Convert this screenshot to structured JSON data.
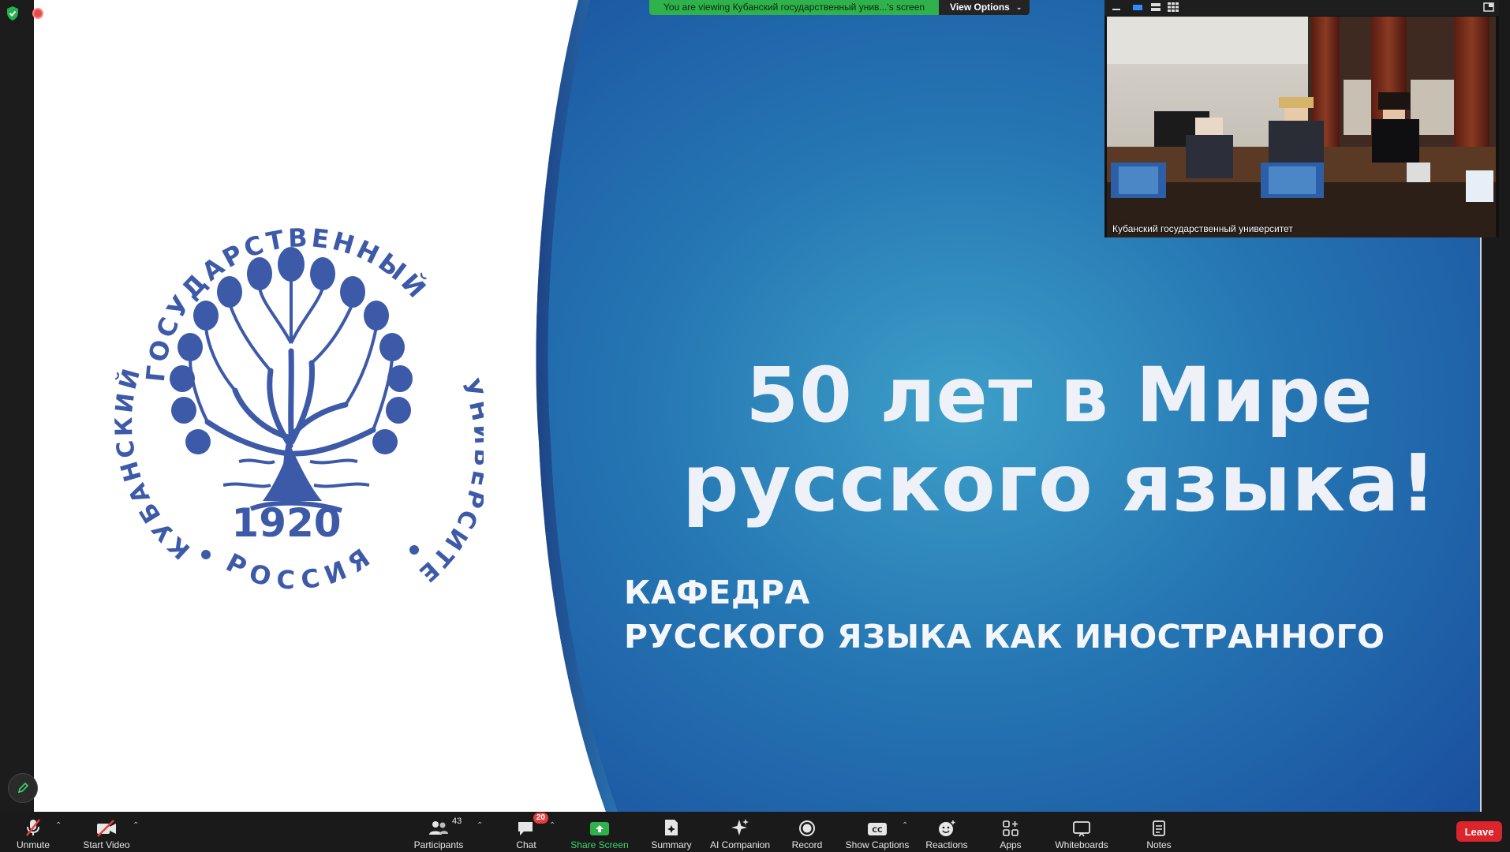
{
  "share_banner": {
    "message": "You are viewing Кубанский государственный унив...'s screen",
    "options_label": "View Options"
  },
  "video": {
    "participant_name": "Кубанский государственный университет"
  },
  "slide": {
    "logo_top_arc": "ГОСУДАРСТВЕННЫЙ",
    "logo_left_arc": "КУБАНСКИЙ",
    "logo_right_arc": "УНИВЕРСИТЕТ",
    "logo_bottom_arc": "РОССИЯ",
    "logo_year": "1920",
    "title_line1": "50 лет в Мире",
    "title_line2": "русского языка!",
    "subtitle_line1": "КАФЕДРА",
    "subtitle_line2": "РУССКОГО ЯЗЫКА КАК ИНОСТРАННОГО",
    "colors": {
      "slide_blue": "#1e5fa8",
      "logo_blue": "#3d5aa8"
    }
  },
  "toolbar": {
    "unmute": "Unmute",
    "start_video": "Start Video",
    "participants": "Participants",
    "participants_count": "43",
    "chat": "Chat",
    "chat_badge": "20",
    "share_screen": "Share Screen",
    "summary": "Summary",
    "ai_companion": "AI Companion",
    "record": "Record",
    "show_captions": "Show Captions",
    "reactions": "Reactions",
    "apps": "Apps",
    "whiteboards": "Whiteboards",
    "notes": "Notes",
    "leave": "Leave",
    "cc_glyph": "CC"
  }
}
